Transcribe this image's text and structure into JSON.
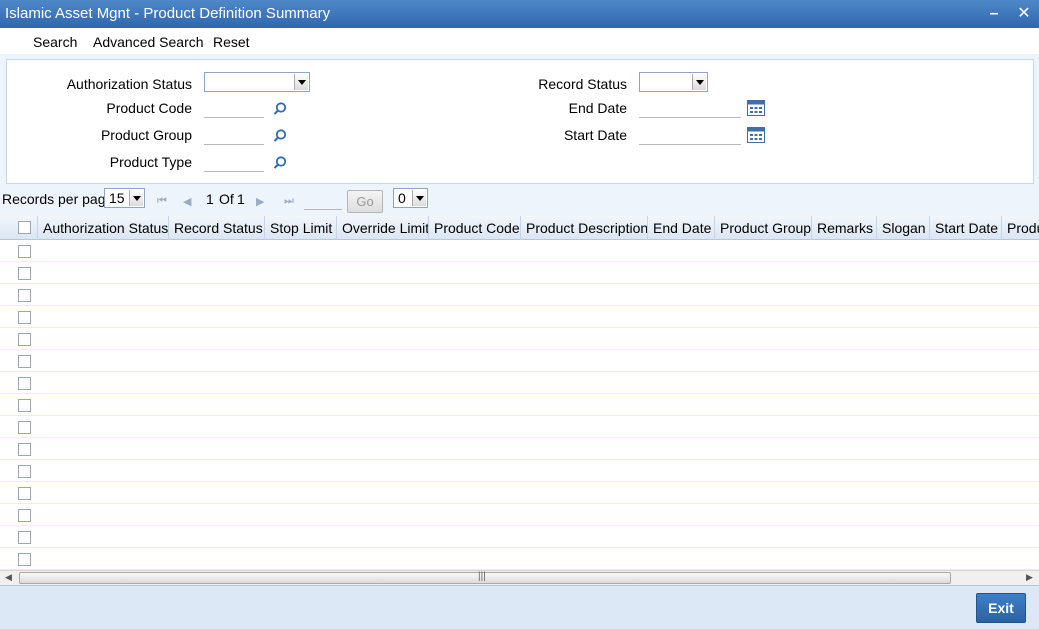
{
  "window": {
    "title": "Islamic Asset Mgnt - Product Definition Summary",
    "minimize_icon": "minimize-icon",
    "close_icon": "close-icon"
  },
  "toolbar": {
    "search_label": "Search",
    "advanced_search_label": "Advanced Search",
    "reset_label": "Reset"
  },
  "criteria": {
    "authorization_status": {
      "label": "Authorization Status",
      "value": ""
    },
    "record_status": {
      "label": "Record Status",
      "value": ""
    },
    "product_code": {
      "label": "Product Code",
      "value": ""
    },
    "end_date": {
      "label": "End Date",
      "value": ""
    },
    "product_group": {
      "label": "Product Group",
      "value": ""
    },
    "start_date": {
      "label": "Start Date",
      "value": ""
    },
    "product_type": {
      "label": "Product Type",
      "value": ""
    }
  },
  "pager": {
    "records_per_page_label": "Records per page",
    "records_per_page": "15",
    "current_page": "1",
    "of_label": "Of",
    "total_pages": "1",
    "goto_value": "",
    "go_label": "Go",
    "extra_select": "0"
  },
  "grid": {
    "columns": [
      "Authorization Status",
      "Record Status",
      "Stop Limit",
      "Override Limit",
      "Product Code",
      "Product Description",
      "End Date",
      "Product Group",
      "Remarks",
      "Slogan",
      "Start Date",
      "Product"
    ],
    "row_count": 15
  },
  "footer": {
    "exit_label": "Exit"
  },
  "colors": {
    "title_bar": "#2f67ae",
    "frame_bg": "#eef4fb",
    "exit_button": "#2b63a6"
  }
}
